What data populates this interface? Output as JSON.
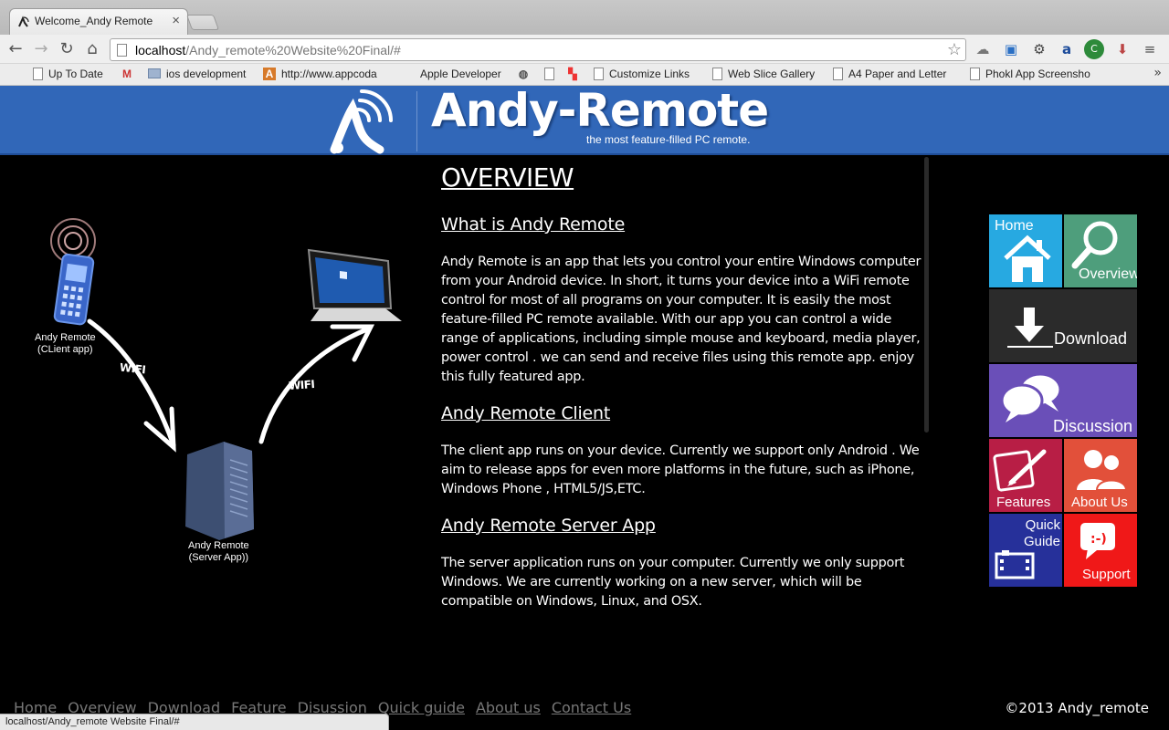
{
  "browser": {
    "tab_title": "Welcome_Andy Remote",
    "tab_close": "×",
    "url_host": "localhost",
    "url_path": "/Andy_remote%20Website%20Final/#",
    "bookmarks": [
      {
        "label": "Up To Date",
        "icon": "page-icon"
      },
      {
        "label": "",
        "icon": "gmail-icon"
      },
      {
        "label": "ios development",
        "icon": "folder-icon"
      },
      {
        "label": "http://www.appcoda",
        "icon": "appcoda-icon"
      },
      {
        "label": "Apple Developer",
        "icon": "apple-icon"
      },
      {
        "label": "",
        "icon": "globe-icon"
      },
      {
        "label": "",
        "icon": "page-icon"
      },
      {
        "label": "",
        "icon": "windows-icon"
      },
      {
        "label": "Customize Links",
        "icon": "page-icon"
      },
      {
        "label": "Web Slice Gallery",
        "icon": "page-icon"
      },
      {
        "label": "A4 Paper and Letter",
        "icon": "page-icon"
      },
      {
        "label": "Phokl App Screensho",
        "icon": "page-icon"
      }
    ],
    "bookmarks_more": "»",
    "status_text": "localhost/Andy_remote Website Final/#"
  },
  "header": {
    "title": "Andy-Remote",
    "tagline": "the most feature-filled PC remote."
  },
  "diagram": {
    "client_label": [
      "Andy Remote",
      "(CLient app)"
    ],
    "server_label": [
      "Andy Remote",
      "(Server App))"
    ],
    "wifi_label_1": "WIFI",
    "wifi_label_2": "WIFI"
  },
  "content": {
    "heading": "OVERVIEW",
    "sections": [
      {
        "title": "What is Andy Remote",
        "body": "Andy Remote is an app that lets you control your entire Windows computer from your Android device. In short, it turns your device into a WiFi remote control for most of all programs on your computer. It is easily the most feature-filled PC remote available. With our app you can control a wide range of applications, including simple mouse and keyboard, media player, power control . we can send and receive files using this remote app. enjoy this fully featured app."
      },
      {
        "title": "Andy Remote Client",
        "body": "The client app runs on your device. Currently we support only Android . We aim to release apps for even more platforms in the future, such as iPhone, Windows Phone , HTML5/JS,ETC."
      },
      {
        "title": "Andy Remote Server App",
        "body": "The server application runs on your computer. Currently we only support Windows. We are currently working on a new server, which will be compatible on Windows, Linux, and OSX."
      }
    ]
  },
  "tiles": {
    "home": "Home",
    "overview": "Overview",
    "download": "Download",
    "discussion": "Discussion",
    "features": "Features",
    "about": "About Us",
    "quick_guide": [
      "Quick",
      "Guide"
    ],
    "support": "Support",
    "colors": {
      "home": "#27a9e1",
      "overview": "#4e9e7c",
      "download": "#2b2b2b",
      "discussion": "#6a4fb8",
      "features": "#b81e45",
      "about": "#e2503a",
      "quick_guide": "#26309a",
      "support": "#f01818"
    }
  },
  "footer": {
    "nav": [
      "Home",
      "Overview",
      "Download",
      "Feature",
      "Disussion",
      "Quick guide",
      "About us",
      "Contact Us"
    ],
    "copyright": "©2013 Andy_remote"
  }
}
